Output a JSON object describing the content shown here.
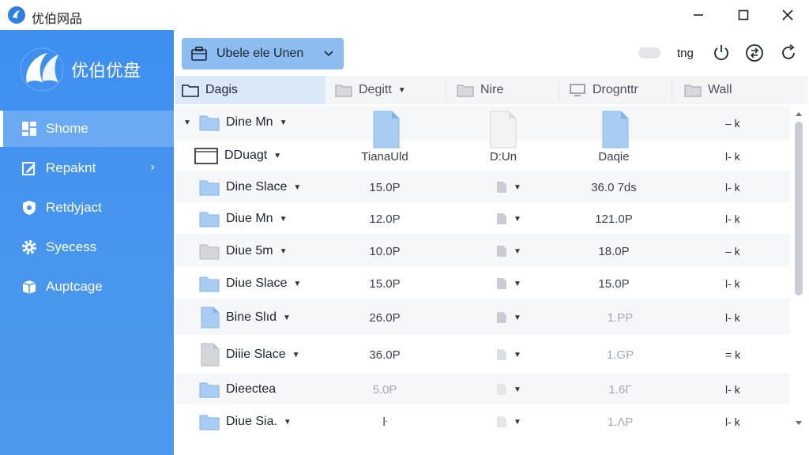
{
  "window": {
    "title": "优伯网品",
    "controls": [
      "minimize-icon",
      "maximize-icon",
      "close-icon"
    ]
  },
  "sidebar": {
    "brand_name": "优伯优盘",
    "items": [
      {
        "label": "Shome",
        "icon": "home-grid-icon",
        "active": true
      },
      {
        "label": "Repaknt",
        "icon": "edit-report-icon",
        "has_chevron": true
      },
      {
        "label": "Retdyjact",
        "icon": "shield-icon"
      },
      {
        "label": "Syecess",
        "icon": "gear-icon"
      },
      {
        "label": "Auptcage",
        "icon": "package-icon"
      }
    ]
  },
  "toolbar": {
    "drive_label": "Ubele ele Unen",
    "toggle_label": "tng",
    "icons": [
      "power-icon",
      "sync-icon",
      "refresh-icon"
    ]
  },
  "tabs": [
    {
      "label": "Dagis",
      "active": true
    },
    {
      "label": "Degitt",
      "dropdown": true
    },
    {
      "label": "Nire"
    },
    {
      "label": "Drognttr"
    },
    {
      "label": "Wall"
    }
  ],
  "rows": [
    {
      "name": "Dine Mn",
      "icon": "folder",
      "caret": true,
      "expander": true,
      "size": "",
      "date": "",
      "action": "– k",
      "header_files": true
    },
    {
      "name": "DDuagt",
      "icon": "box-folder",
      "caret": true,
      "size": "TianaUld",
      "date": "Daqie",
      "type_text": "D:Un",
      "action": "l- k"
    },
    {
      "name": "Dine Slace",
      "icon": "folder",
      "caret": true,
      "size": "15.0P",
      "date": "36.0 7ds",
      "action": "l- k"
    },
    {
      "name": "Diue Mn",
      "icon": "folder",
      "caret": true,
      "size": "12.0P",
      "date": "121.0P",
      "action": "l- k"
    },
    {
      "name": "Diue 5m",
      "icon": "folder-gray",
      "caret": true,
      "size": "10.0P",
      "date": "18.0P",
      "action": "– k"
    },
    {
      "name": "Diue Slace",
      "icon": "folder",
      "caret": true,
      "size": "15.0P",
      "date": "15.0P",
      "action": "l- k"
    },
    {
      "name": "Bine Slıd",
      "icon": "file-blue",
      "caret": true,
      "size": "26.0P",
      "date": "1.PP",
      "action": "l- k"
    },
    {
      "name": "Diiie Slace",
      "icon": "file-gray",
      "caret": true,
      "size": "36.0P",
      "date": "1.GP",
      "action": "= k"
    },
    {
      "name": "Dieectea",
      "icon": "folder",
      "caret": false,
      "size": "5.0P",
      "date": "1.6Γ",
      "action": "l- k"
    },
    {
      "name": "Diue Sia.",
      "icon": "folder",
      "caret": true,
      "size": "ŀ",
      "date": "1.ΛP",
      "action": "l- k"
    }
  ],
  "colors": {
    "sidebar": "#3d8ff0",
    "accent": "#2f7fe0",
    "drive_select": "#8dbcf0",
    "active_tab": "#dbe8f8",
    "folder": "#a9cdf2"
  }
}
